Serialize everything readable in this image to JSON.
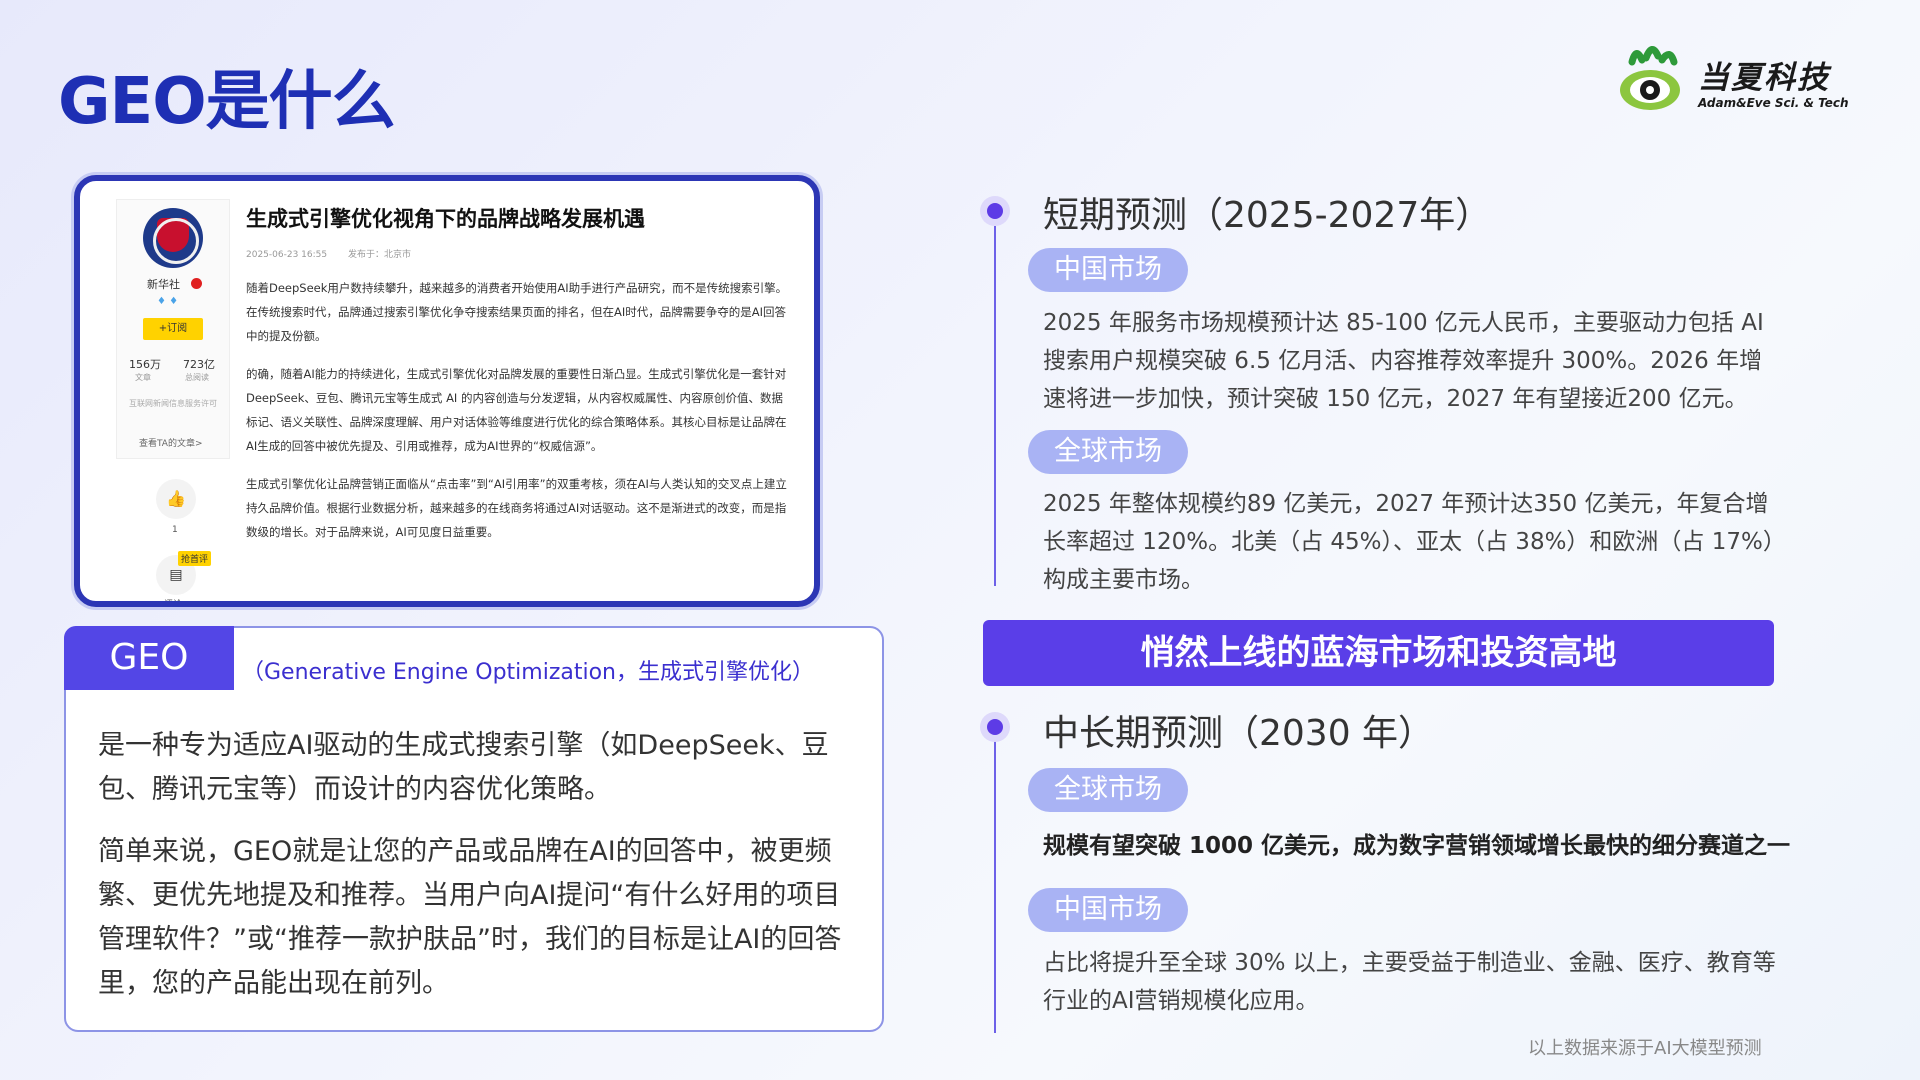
{
  "title": "GEO是什么",
  "logo": {
    "name_cn": "当夏科技",
    "name_en": "Adam&Eve Sci. & Tech"
  },
  "screenshot": {
    "account": "新华社",
    "subscribe": "+订阅",
    "stat1_value": "156万",
    "stat1_label": "文章",
    "stat2_value": "723亿",
    "stat2_label": "总阅读",
    "license": "互联网新闻信息服务许可",
    "more": "查看TA的文章>",
    "like_count": "1",
    "sofa": "抢首评",
    "comment_label": "评论",
    "article_title": "生成式引擎优化视角下的品牌战略发展机遇",
    "date": "2025-06-23 16:55",
    "location": "发布于：北京市",
    "para1": "随着DeepSeek用户数持续攀升，越来越多的消费者开始使用AI助手进行产品研究，而不是传统搜索引擎。在传统搜索时代，品牌通过搜索引擎优化争夺搜索结果页面的排名，但在AI时代，品牌需要争夺的是AI回答中的提及份额。",
    "para2": "的确，随着AI能力的持续进化，生成式引擎优化对品牌发展的重要性日渐凸显。生成式引擎优化是一套针对DeepSeek、豆包、腾讯元宝等生成式 AI 的内容创造与分发逻辑，从内容权威属性、内容原创价值、数据标记、语义关联性、品牌深度理解、用户对话体验等维度进行优化的综合策略体系。其核心目标是让品牌在AI生成的回答中被优先提及、引用或推荐，成为AI世界的“权威信源”。",
    "para3": "生成式引擎优化让品牌营销正面临从“点击率”到“AI引用率”的双重考核，须在AI与人类认知的交叉点上建立持久品牌价值。根据行业数据分析，越来越多的在线商务将通过AI对话驱动。这不是渐进式的改变，而是指数级的增长。对于品牌来说，AI可见度日益重要。"
  },
  "definition": {
    "tag": "GEO",
    "subtitle": "（Generative Engine Optimization，生成式引擎优化）",
    "para1": "是一种专为适应AI驱动的生成式搜索引擎（如DeepSeek、豆包、腾讯元宝等）而设计的内容优化策略。",
    "para2": "简单来说，GEO就是让您的产品或品牌在AI的回答中，被更频繁、更优先地提及和推荐。当用户向AI提问“有什么好用的项目管理软件？”或“推荐一款护肤品”时，我们的目标是让AI的回答里，您的产品能出现在前列。"
  },
  "short_term": {
    "heading": "短期预测（2025-2027年）",
    "china_label": "中国市场",
    "china_text": "2025 年服务市场规模预计达 85-100 亿元人民币，主要驱动力包括 AI 搜索用户规模突破 6.5 亿月活、内容推荐效率提升 300%。2026 年增速将进一步加快，预计突破 150 亿元，2027 年有望接近200 亿元。",
    "global_label": "全球市场",
    "global_text": "2025 年整体规模约89 亿美元，2027 年预计达350 亿美元，年复合增长率超过 120%。北美（占 45%）、亚太（占 38%）和欧洲（占 17%）构成主要市场。"
  },
  "banner": "悄然上线的蓝海市场和投资高地",
  "long_term": {
    "heading": "中长期预测（2030 年）",
    "global_label": "全球市场",
    "global_text": "规模有望突破 1000 亿美元，成为数字营销领域增长最快的细分赛道之一",
    "china_label": "中国市场",
    "china_text": "占比将提升至全球 30% 以上，主要受益于制造业、金融、医疗、教育等行业的AI营销规模化应用。"
  },
  "source_note": "以上数据来源于AI大模型预测",
  "colors": {
    "brand_blue": "#1e2fb4",
    "accent_purple": "#5a3ee8",
    "pill": "#a9b3f4"
  }
}
